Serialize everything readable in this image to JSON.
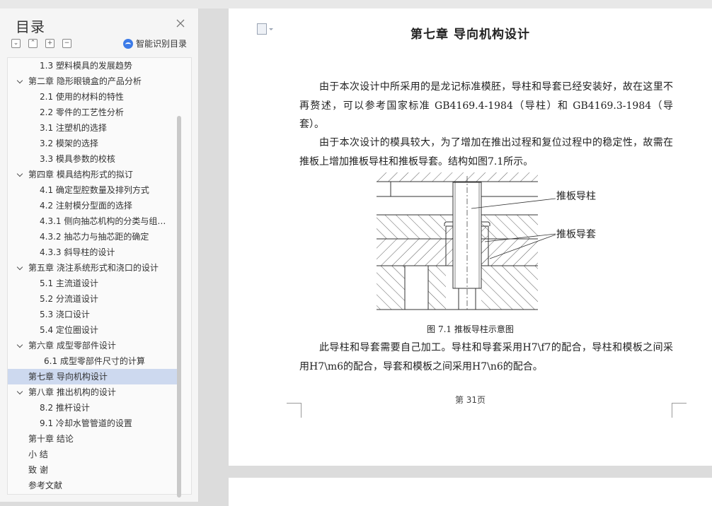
{
  "sidebar": {
    "title": "目录",
    "smart_toc_label": "智能识别目录",
    "toc_items": [
      {
        "label": "1.3  塑料模具的发展趋势",
        "level": 2
      },
      {
        "label": "第二章  隐形眼镜盒的产品分析",
        "level": 1,
        "expanded": true
      },
      {
        "label": "2.1 使用的材料的特性",
        "level": 2
      },
      {
        "label": "2.2  零件的工艺性分析",
        "level": 2
      },
      {
        "label": "3.1  注塑机的选择",
        "level": 2
      },
      {
        "label": "3.2  模架的选择",
        "level": 2
      },
      {
        "label": "3.3  模具参数的校核",
        "level": 2
      },
      {
        "label": "第四章  模具结构形式的拟订",
        "level": 1,
        "expanded": true
      },
      {
        "label": "4.1  确定型腔数量及排列方式",
        "level": 2
      },
      {
        "label": "4.2  注射模分型面的选择",
        "level": 2
      },
      {
        "label": "4.3.1  侧向抽芯机构的分类与组…",
        "level": 2
      },
      {
        "label": "4.3.2  抽芯力与抽芯距的确定",
        "level": 2
      },
      {
        "label": "4.3.3  斜导柱的设计",
        "level": 2
      },
      {
        "label": "第五章  浇注系统形式和浇口的设计",
        "level": 1,
        "expanded": true
      },
      {
        "label": "5.1 主流道设计",
        "level": 2
      },
      {
        "label": "5.2  分流道设计",
        "level": 2
      },
      {
        "label": "5.3  浇口设计",
        "level": 2
      },
      {
        "label": "5.4  定位圈设计",
        "level": 2
      },
      {
        "label": "第六章  成型零部件设计",
        "level": 1,
        "expanded": true
      },
      {
        "label": "6.1  成型零部件尺寸的计算",
        "level": 3
      },
      {
        "label": "第七章  导向机构设计",
        "level": 1,
        "selected": true
      },
      {
        "label": "第八章  推出机构的设计",
        "level": 1,
        "expanded": true
      },
      {
        "label": "8.2  推杆设计",
        "level": 2
      },
      {
        "label": "9.1  冷却水管管道的设置",
        "level": 2
      },
      {
        "label": "第十章  结论",
        "level": 1
      },
      {
        "label": "小    结",
        "level": 1
      },
      {
        "label": "致  谢",
        "level": 1
      },
      {
        "label": "参考文献",
        "level": 1
      }
    ]
  },
  "document": {
    "chapter_title": "第七章  导向机构设计",
    "para1": "由于本次设计中所采用的是龙记标准模胚，导柱和导套已经安装好，故在这里不再赘述，可以参考国家标准 GB4169.4-1984（导柱）和 GB4169.3-1984（导套）。",
    "para2": "由于本次设计的模具较大，为了增加在推出过程和复位过程中的稳定性，故需在推板上增加推板导柱和推板导套。结构如图7.1所示。",
    "figure_label_pillar": "推板导柱",
    "figure_label_sleeve": "推板导套",
    "figure_caption": "图 7.1  推板导柱示意图",
    "para3": "此导柱和导套需要自己加工。导柱和导套采用H7\\f7的配合，导柱和模板之间采用H7\\m6的配合，导套和模板之间采用H7\\n6的配合。",
    "page_number": "第 31页"
  },
  "colors": {
    "selected_item_bg": "#cdd9ef",
    "smart_toc_icon": "#3c7be8"
  }
}
